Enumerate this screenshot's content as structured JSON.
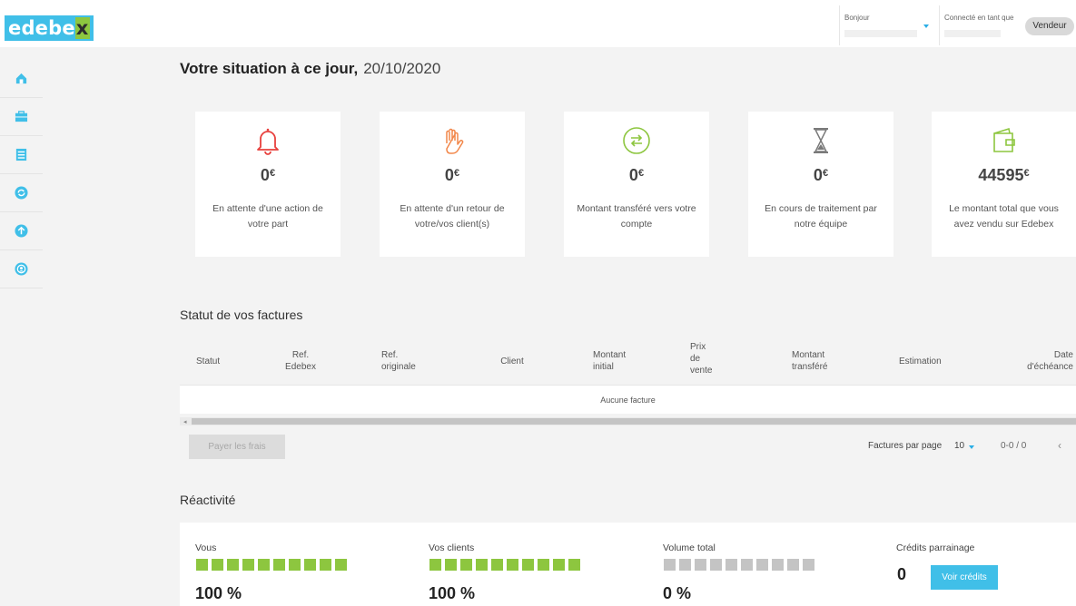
{
  "header": {
    "logo_prefix": "edebe",
    "logo_highlight": "x",
    "greeting": "Bonjour",
    "logged_in_label": "Connecté en tant que",
    "role_badge": "Vendeur"
  },
  "sidebar": {
    "items": [
      {
        "icon": "home-icon"
      },
      {
        "icon": "briefcase-icon"
      },
      {
        "icon": "document-list-icon"
      },
      {
        "icon": "refresh-circle-icon"
      },
      {
        "icon": "upload-circle-icon"
      },
      {
        "icon": "referral-icon"
      }
    ]
  },
  "page": {
    "title": "Votre situation à ce jour,",
    "date": "20/10/2020"
  },
  "cards": [
    {
      "amount": "0",
      "currency": "€",
      "desc": "En attente d'une action de votre part",
      "icon": "bell-icon",
      "color": "#e8403d"
    },
    {
      "amount": "0",
      "currency": "€",
      "desc": "En attente d'un retour de votre/vos client(s)",
      "icon": "hand-icon",
      "color": "#f2874a"
    },
    {
      "amount": "0",
      "currency": "€",
      "desc": "Montant transféré vers votre compte",
      "icon": "transfer-icon",
      "color": "#8dc63f"
    },
    {
      "amount": "0",
      "currency": "€",
      "desc": "En cours de traitement par notre équipe",
      "icon": "hourglass-icon",
      "color": "#7a7a7a"
    },
    {
      "amount": "44595",
      "currency": "€",
      "desc": "Le montant total que vous avez vendu sur Edebex",
      "icon": "wallet-icon",
      "color": "#8dc63f"
    }
  ],
  "invoices": {
    "title": "Statut de vos factures",
    "columns": [
      "Statut",
      "Ref. Edebex",
      "Ref. originale",
      "Client",
      "Montant initial",
      "Prix de vente",
      "Montant transféré",
      "Estimation",
      "Date d'échéance"
    ],
    "empty_text": "Aucune facture",
    "pay_button": "Payer les frais",
    "per_page_label": "Factures par page",
    "per_page_value": "10",
    "range": "0-0 / 0",
    "prev_icon": "‹"
  },
  "reactivity": {
    "title": "Réactivité",
    "blocks": [
      {
        "label": "Vous",
        "percent": "100 %",
        "filled": 10,
        "total": 10,
        "color": "#8dc63f"
      },
      {
        "label": "Vos clients",
        "percent": "100 %",
        "filled": 10,
        "total": 10,
        "color": "#8dc63f"
      },
      {
        "label": "Volume total",
        "percent": "0 %",
        "filled": 0,
        "total": 10,
        "color": "#c4c4c4"
      }
    ],
    "credits_label": "Crédits parrainage",
    "credits_value": "0",
    "credits_button": "Voir crédits"
  }
}
